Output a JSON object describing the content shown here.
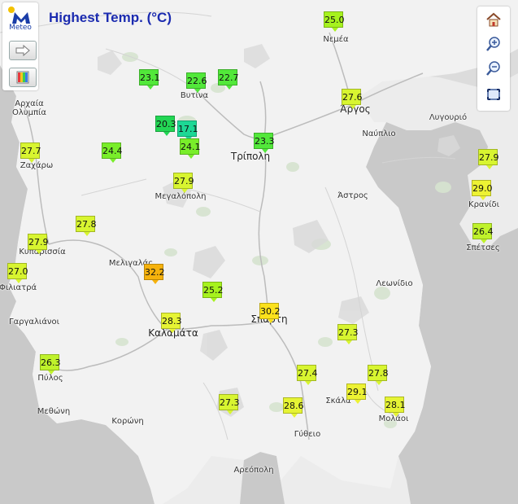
{
  "title": "Highest Temp. (°C)",
  "logo": {
    "text": "Meteo",
    "accent": "#f3c200",
    "brand": "#1a3da8"
  },
  "left_controls": [
    {
      "name": "next-arrow-icon"
    },
    {
      "name": "legend-palette-icon"
    }
  ],
  "right_controls": [
    {
      "name": "home-icon"
    },
    {
      "name": "zoom-in-icon"
    },
    {
      "name": "zoom-out-icon"
    },
    {
      "name": "fit-extent-icon"
    }
  ],
  "places": [
    {
      "name": "Νεμέα"
    },
    {
      "name": "Αρχαία Ολυμπία"
    },
    {
      "name": "Βυτίνα"
    },
    {
      "name": "Άργος"
    },
    {
      "name": "Ναύπλιο"
    },
    {
      "name": "Λυγουριό"
    },
    {
      "name": "Ζαχάρω"
    },
    {
      "name": "Τρίπολη"
    },
    {
      "name": "Μεγαλόπολη"
    },
    {
      "name": "Άστρος"
    },
    {
      "name": "Κρανίδι"
    },
    {
      "name": "Κυπαρισσία"
    },
    {
      "name": "Μελιγαλάς"
    },
    {
      "name": "Φιλιατρά"
    },
    {
      "name": "Σπέτσες"
    },
    {
      "name": "Λεωνίδιο"
    },
    {
      "name": "Γαργαλιάνοι"
    },
    {
      "name": "Καλαμάτα"
    },
    {
      "name": "Σπάρτη"
    },
    {
      "name": "Πύλος"
    },
    {
      "name": "Σκάλα"
    },
    {
      "name": "Μεθώνη"
    },
    {
      "name": "Κορώνη"
    },
    {
      "name": "Μολάοι"
    },
    {
      "name": "Γύθειο"
    },
    {
      "name": "Αρεόπολη"
    }
  ],
  "readings": [
    {
      "value": "25.0",
      "color": "#a6f21e"
    },
    {
      "value": "23.1",
      "color": "#52e83a"
    },
    {
      "value": "22.6",
      "color": "#52e83a"
    },
    {
      "value": "22.7",
      "color": "#52e83a"
    },
    {
      "value": "27.6",
      "color": "#d8f530"
    },
    {
      "value": "20.3",
      "color": "#23d654"
    },
    {
      "value": "17.1",
      "color": "#1dd895"
    },
    {
      "value": "24.1",
      "color": "#79ee2a"
    },
    {
      "value": "23.3",
      "color": "#52e83a"
    },
    {
      "value": "27.7",
      "color": "#d8f530"
    },
    {
      "value": "24.4",
      "color": "#79ee2a"
    },
    {
      "value": "27.9",
      "color": "#d8f530"
    },
    {
      "value": "27.9",
      "color": "#d8f530"
    },
    {
      "value": "29.0",
      "color": "#edf233"
    },
    {
      "value": "27.8",
      "color": "#d8f530"
    },
    {
      "value": "26.4",
      "color": "#bff22b"
    },
    {
      "value": "27.9",
      "color": "#d8f530"
    },
    {
      "value": "27.0",
      "color": "#d8f530"
    },
    {
      "value": "32.2",
      "color": "#f6b20c"
    },
    {
      "value": "25.2",
      "color": "#a6f21e"
    },
    {
      "value": "28.3",
      "color": "#e6f434"
    },
    {
      "value": "30.2",
      "color": "#fbe11c"
    },
    {
      "value": "27.3",
      "color": "#d8f530"
    },
    {
      "value": "26.3",
      "color": "#bff22b"
    },
    {
      "value": "27.4",
      "color": "#d8f530"
    },
    {
      "value": "27.8",
      "color": "#d8f530"
    },
    {
      "value": "29.1",
      "color": "#edf233"
    },
    {
      "value": "28.1",
      "color": "#e6f434"
    },
    {
      "value": "27.3",
      "color": "#d8f530"
    },
    {
      "value": "28.6",
      "color": "#e6f434"
    }
  ]
}
